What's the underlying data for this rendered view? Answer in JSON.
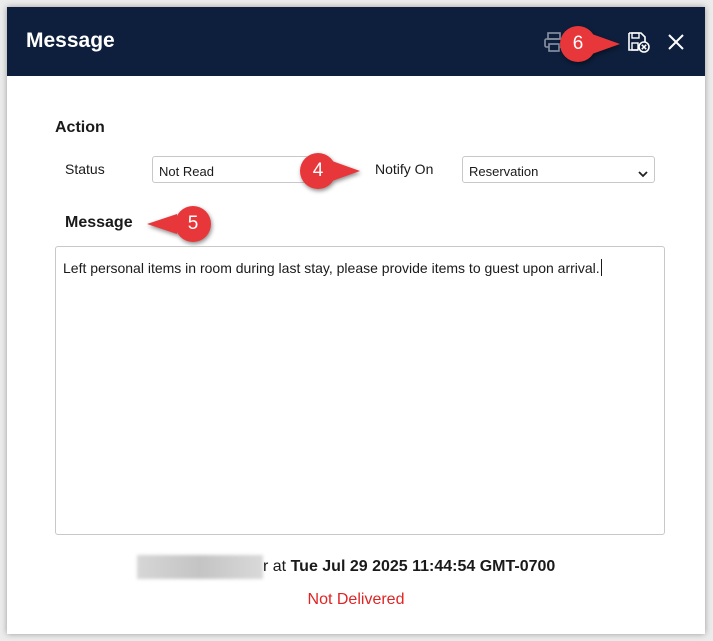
{
  "dialog": {
    "title": "Message",
    "toolbar": {
      "print_icon": "printer-icon",
      "save_close_icon": "save-close-icon",
      "close_icon": "close-icon"
    }
  },
  "action": {
    "heading": "Action",
    "status_label": "Status",
    "status_value": "Not Read",
    "notify_label": "Notify On",
    "notify_value": "Reservation"
  },
  "message": {
    "heading": "Message",
    "body": "Left personal items in room during last stay, please provide items to guest upon arrival."
  },
  "footer": {
    "name_suffix": "r",
    "at_text": "at",
    "timestamp": "Tue Jul 29 2025 11:44:54 GMT-0700",
    "delivery_status": "Not Delivered"
  },
  "callouts": {
    "c4": "4",
    "c5": "5",
    "c6": "6"
  },
  "colors": {
    "titlebar": "#0d1f3c",
    "callout": "#e8373a",
    "delivery_status": "#e02424"
  }
}
